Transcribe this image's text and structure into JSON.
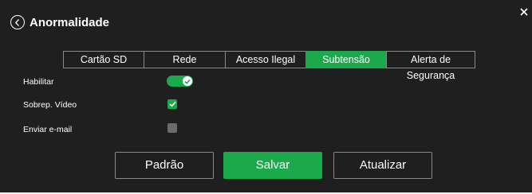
{
  "dialog": {
    "title": "Anormalidade",
    "back_icon": "chevron-left-circle-icon",
    "close_icon": "close-icon"
  },
  "tabs": [
    {
      "label": "Cartão SD",
      "active": false
    },
    {
      "label": "Rede",
      "active": false
    },
    {
      "label": "Acesso Ilegal",
      "active": false
    },
    {
      "label": "Subtensão",
      "active": true
    },
    {
      "label": "Alerta de Segurança",
      "active": false
    }
  ],
  "settings": {
    "habilitar": {
      "label": "Habilitar",
      "value": true
    },
    "sobrep_video": {
      "label": "Sobrep. Vídeo",
      "value": true
    },
    "enviar_email": {
      "label": "Enviar e-mail",
      "value": false
    }
  },
  "buttons": {
    "padrao": "Padrão",
    "salvar": "Salvar",
    "atualizar": "Atualizar"
  },
  "colors": {
    "accent": "#1aaa4b",
    "background": "#1f1f1f",
    "text": "#ffffff"
  }
}
